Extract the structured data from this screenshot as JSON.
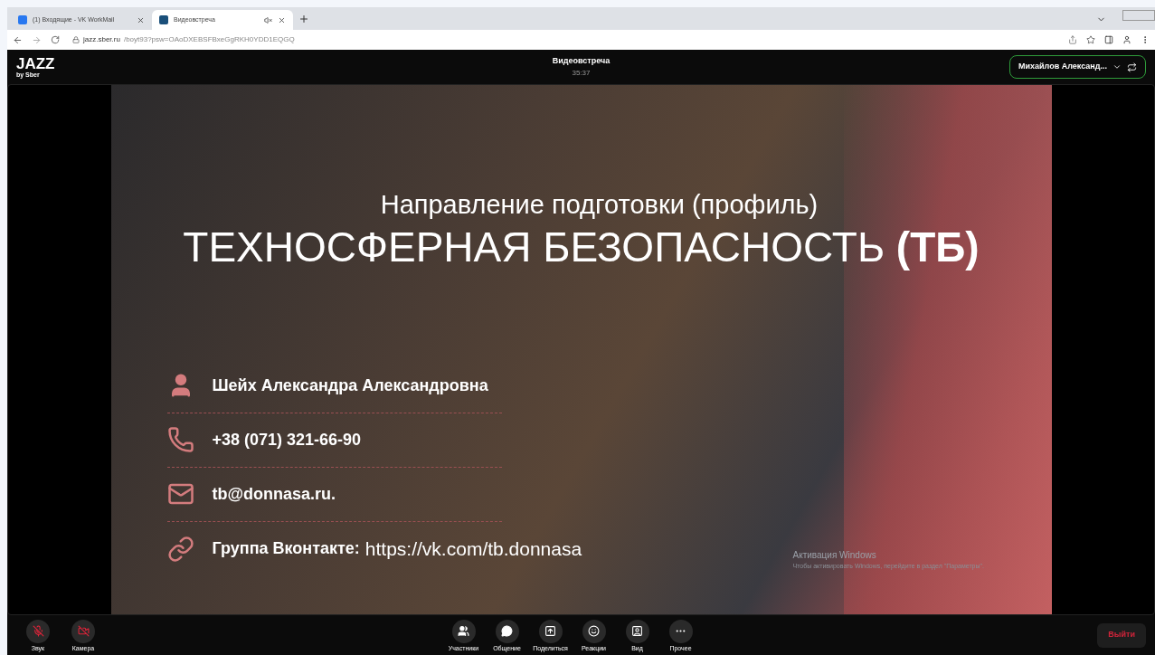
{
  "browser": {
    "tabs": [
      {
        "title": "(1) Входящие - VK WorkMail",
        "selected": false,
        "audio": false
      },
      {
        "title": "Видеовстреча",
        "selected": true,
        "audio": true
      }
    ],
    "url_host": "jazz.sber.ru",
    "url_path": "/boyt93?psw=OAoDXEBSFBxeGgRKH0YDD1EQGQ"
  },
  "app": {
    "logo": "JAZZ",
    "logo_sub": "by Sber",
    "meeting_title": "Видеовстреча",
    "timer": "35:37",
    "speaker": "Михайлов Александ..."
  },
  "slide": {
    "subtitle": "Направление подготовки (профиль)",
    "title": "ТЕХНОСФЕРНАЯ БЕЗОПАСНОСТЬ **(ТБ)**",
    "contacts": [
      {
        "kind": "person",
        "text": "Шейх Александра Александровна"
      },
      {
        "kind": "phone",
        "text": "+38 (071) 321-66-90"
      },
      {
        "kind": "email",
        "text": "tb@donnasa.ru."
      },
      {
        "kind": "link",
        "label": "Группа Вконтакте:",
        "text": "https://vk.com/tb.donnasa"
      }
    ]
  },
  "os_notice": {
    "title": "Активация Windows",
    "text": "Чтобы активировать Windows, перейдите в раздел \"Параметры\"."
  },
  "toolbar": {
    "left": [
      {
        "kind": "mic",
        "label": "Звук",
        "off": true
      },
      {
        "kind": "camera",
        "label": "Камера",
        "off": true
      }
    ],
    "center": [
      {
        "kind": "participants",
        "label": "Участники"
      },
      {
        "kind": "chat",
        "label": "Общение"
      },
      {
        "kind": "share",
        "label": "Поделиться"
      },
      {
        "kind": "reactions",
        "label": "Реакции"
      },
      {
        "kind": "view",
        "label": "Вид"
      },
      {
        "kind": "more",
        "label": "Прочее"
      }
    ],
    "leave": "Выйти"
  }
}
